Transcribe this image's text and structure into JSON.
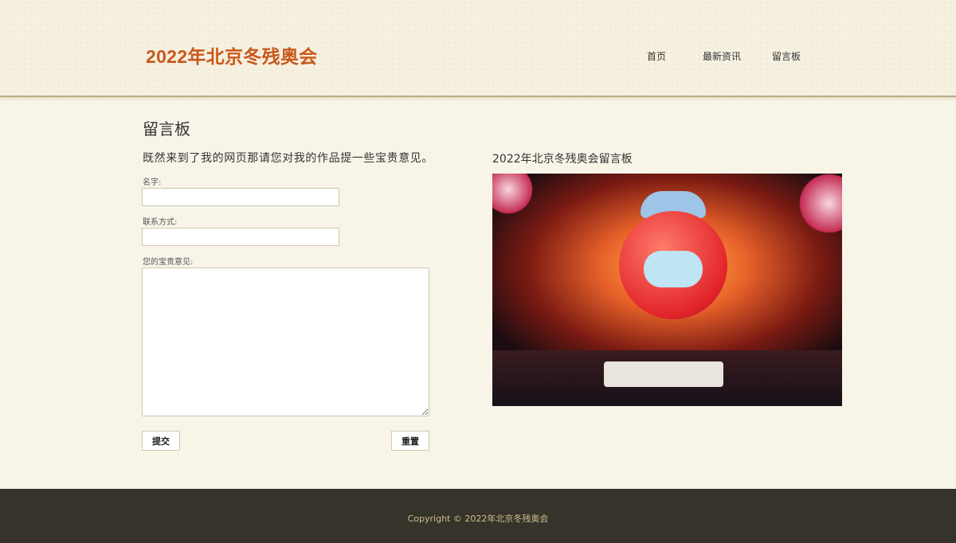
{
  "header": {
    "logo": "2022年北京冬残奥会",
    "nav": [
      "首页",
      "最新资讯",
      "留言板"
    ]
  },
  "main": {
    "page_title": "留言板",
    "intro": "既然来到了我的网页那请您对我的作品提一些宝贵意见。",
    "form": {
      "name_label": "名字:",
      "contact_label": "联系方式:",
      "message_label": "您的宝贵意见:",
      "name_value": "",
      "contact_value": "",
      "message_value": "",
      "submit_label": "提交",
      "reset_label": "重置"
    },
    "side_title": "2022年北京冬残奥会留言板"
  },
  "footer": {
    "copyright": "Copyright © 2022年北京冬残奥会"
  },
  "colors": {
    "logo": "#c9581a",
    "background": "#f8f5e8",
    "footer": "#35332a",
    "footer_text": "#cdbf8e"
  }
}
